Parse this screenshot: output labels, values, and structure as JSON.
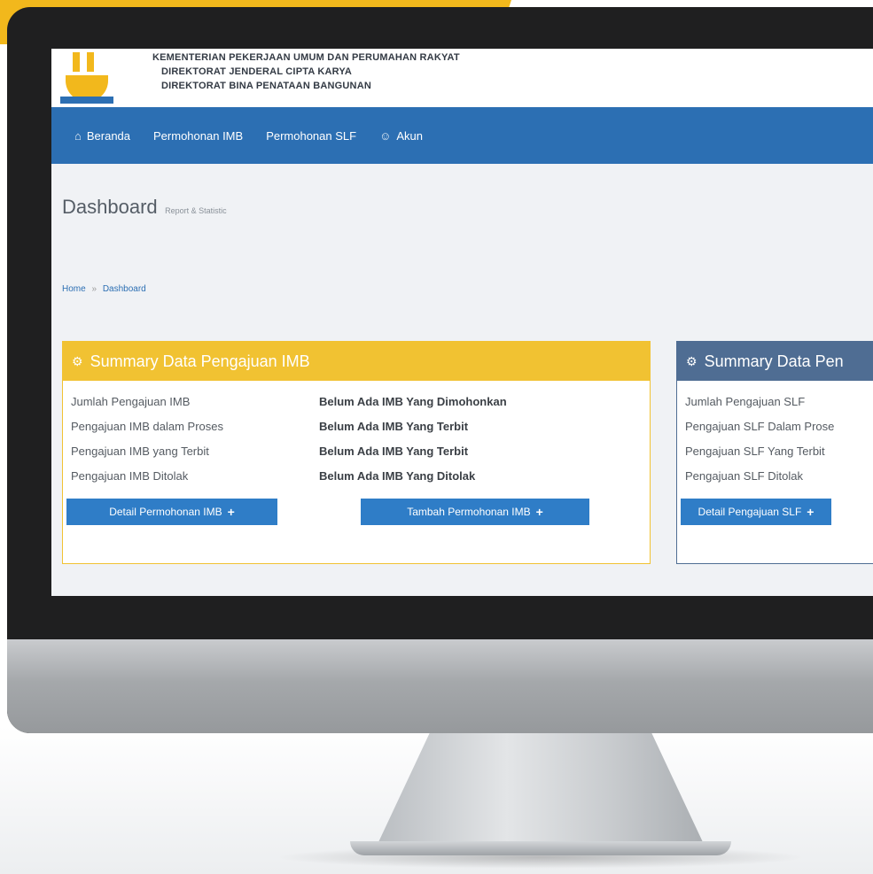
{
  "header": {
    "org_line1": "KEMENTERIAN PEKERJAAN UMUM DAN PERUMAHAN RAKYAT",
    "org_line2": "DIREKTORAT JENDERAL CIPTA KARYA",
    "org_line3": "DIREKTORAT BINA PENATAAN BANGUNAN"
  },
  "nav": {
    "beranda": "Beranda",
    "permohonan_imb": "Permohonan IMB",
    "permohonan_slf": "Permohonan SLF",
    "akun": "Akun"
  },
  "page": {
    "title": "Dashboard",
    "subtitle": "Report & Statistic"
  },
  "breadcrumb": {
    "home": "Home",
    "sep": "»",
    "current": "Dashboard"
  },
  "imb_panel": {
    "title": "Summary Data Pengajuan IMB",
    "rows": [
      {
        "label": "Jumlah Pengajuan IMB",
        "value": "Belum Ada IMB Yang Dimohonkan"
      },
      {
        "label": "Pengajuan IMB dalam Proses",
        "value": "Belum Ada IMB Yang Terbit"
      },
      {
        "label": "Pengajuan IMB yang Terbit",
        "value": "Belum Ada IMB Yang Terbit"
      },
      {
        "label": "Pengajuan IMB Ditolak",
        "value": "Belum Ada IMB Yang Ditolak"
      }
    ],
    "detail_button": "Detail Permohonan IMB",
    "add_button": "Tambah Permohonan IMB"
  },
  "slf_panel": {
    "title": "Summary Data Pen",
    "rows": [
      {
        "label": "Jumlah Pengajuan SLF"
      },
      {
        "label": "Pengajuan SLF Dalam Prose"
      },
      {
        "label": "Pengajuan SLF Yang Terbit"
      },
      {
        "label": "Pengajuan SLF Ditolak"
      }
    ],
    "detail_button": "Detail Pengajuan SLF"
  },
  "colors": {
    "brand_yellow": "#f2b81c",
    "nav_blue": "#2c6fb3",
    "button_blue": "#2f7dc7",
    "slf_header": "#4f6d93"
  },
  "icons": {
    "home": "home-icon",
    "user": "user-icon",
    "gear": "gears-icon",
    "plus": "plus-icon"
  }
}
